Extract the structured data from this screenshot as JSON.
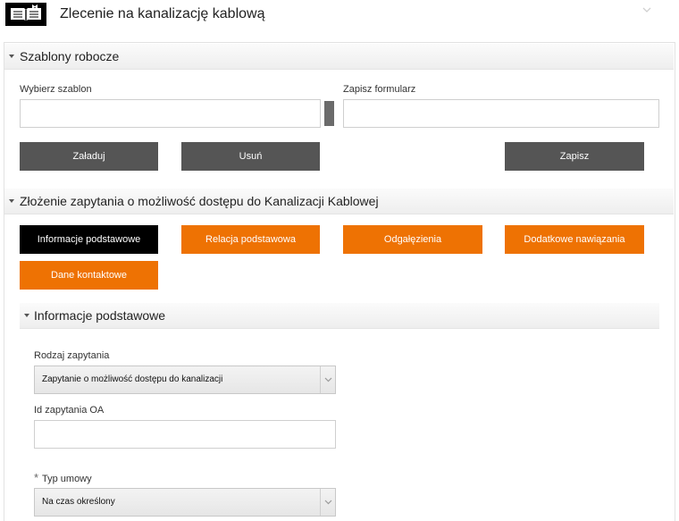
{
  "header": {
    "title": "Zlecenie na kanalizację kablową",
    "icon": "open-book-icon",
    "chevron_icon": "chevron-down-icon"
  },
  "templates_section": {
    "title": "Szablony robocze",
    "choose_label": "Wybierz szablon",
    "choose_value": "",
    "save_form_label": "Zapisz formularz",
    "save_form_value": "",
    "load_button": "Załaduj",
    "delete_button": "Usuń",
    "save_button": "Zapisz"
  },
  "request_section": {
    "title": "Złożenie zapytania o możliwość dostępu do Kanalizacji Kablowej",
    "tabs": [
      {
        "label": "Informacje podstawowe",
        "active": true
      },
      {
        "label": "Relacja podstawowa",
        "active": false
      },
      {
        "label": "Odgałęzienia",
        "active": false
      },
      {
        "label": "Dodatkowe nawiązania",
        "active": false
      },
      {
        "label": "Dane kontaktowe",
        "active": false
      }
    ]
  },
  "basic_info": {
    "title": "Informacje podstawowe",
    "request_type_label": "Rodzaj zapytania",
    "request_type_value": "Zapytanie o możliwość dostępu do kanalizacji",
    "oa_id_label": "Id zapytania OA",
    "oa_id_value": "",
    "contract_type_required": "*",
    "contract_type_label": "Typ umowy",
    "contract_type_value": "Na czas określony"
  },
  "colors": {
    "accent_orange": "#ee7203",
    "button_gray": "#555555",
    "active_tab": "#000000"
  }
}
